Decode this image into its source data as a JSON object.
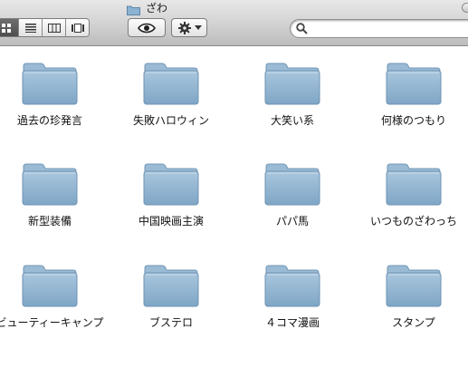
{
  "window": {
    "title": "ざわ"
  },
  "toolbar": {
    "view_buttons": [
      "icon-view",
      "list-view",
      "column-view",
      "coverflow-view"
    ],
    "active_view": "icon-view",
    "quicklook_icon": "eye-icon",
    "action_icon": "gear-icon",
    "search_placeholder": ""
  },
  "folders": [
    {
      "label": "過去の珍発言"
    },
    {
      "label": "失敗ハロウィン"
    },
    {
      "label": "大笑い系"
    },
    {
      "label": "何様のつもり"
    },
    {
      "label": "新型装備"
    },
    {
      "label": "中国映画主演"
    },
    {
      "label": "パパ馬"
    },
    {
      "label": "いつものざわっち"
    },
    {
      "label": "ビューティーキャンプ"
    },
    {
      "label": "ブステロ"
    },
    {
      "label": "４コマ漫画"
    },
    {
      "label": "スタンプ"
    }
  ],
  "colors": {
    "folder_top": "#a9c6dd",
    "folder_bottom": "#7fa6c6",
    "toolbar_bg": "#d2d2d2"
  }
}
